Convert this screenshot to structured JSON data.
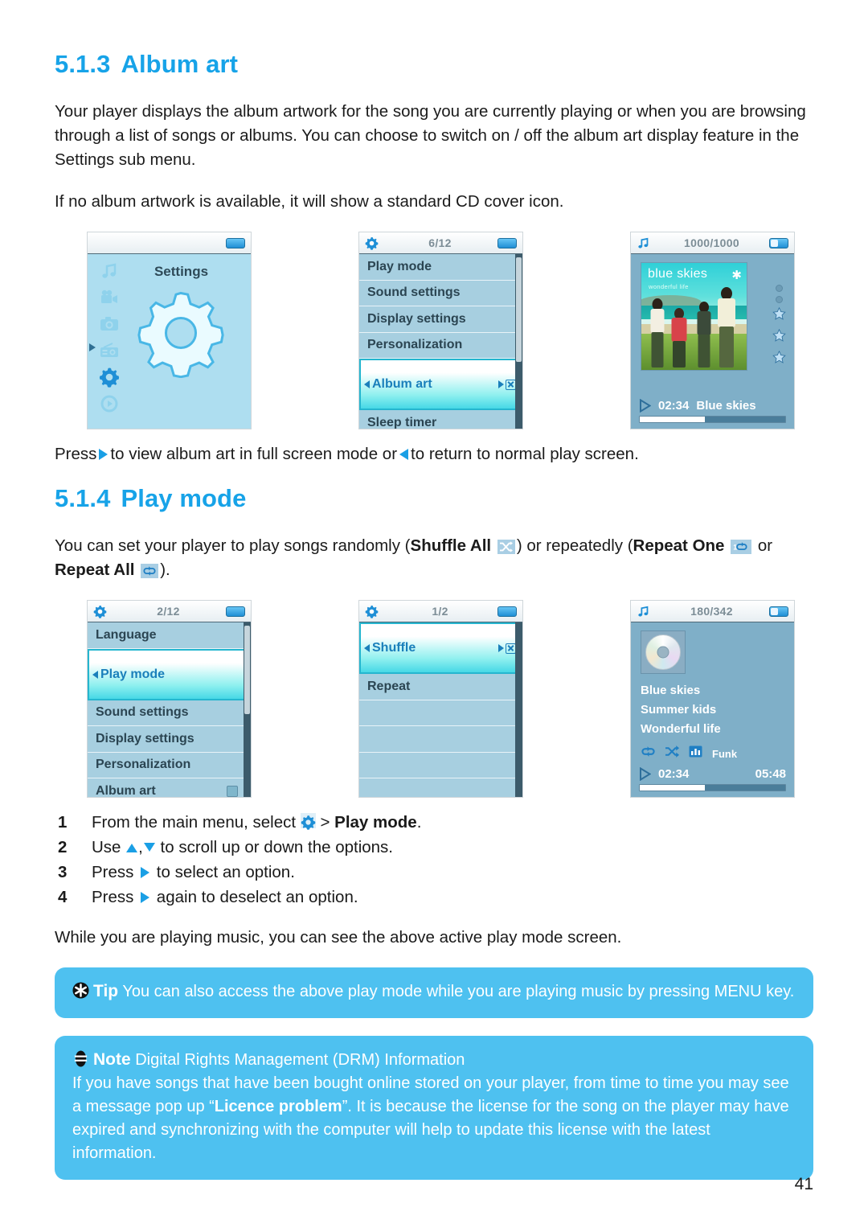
{
  "page": {
    "number": "41",
    "accent_color": "#17A3E8",
    "callout_bg": "#4EC1F0"
  },
  "section_album_art": {
    "num": "5.1.3",
    "title": "Album art",
    "paragraph_1": "Your player displays the album artwork for the song you are currently playing or when you are browsing through a list of songs or albums. You can choose to switch on / off the album art display feature in the Settings sub menu.",
    "paragraph_2": "If no album artwork is available, it will show a standard CD cover icon.",
    "caption_before": "Press",
    "caption_mid": "to view album art in full screen mode or",
    "caption_after": "to return to normal play screen."
  },
  "screens_row1": {
    "screen1": {
      "header_counter": "",
      "title": "Settings",
      "sidebar_icons": [
        "music-note-icon",
        "video-camera-icon",
        "photo-camera-icon",
        "radio-icon",
        "gear-icon",
        "play-circle-icon"
      ],
      "selected_index": 4
    },
    "screen2": {
      "header_icon": "gear-icon",
      "header_counter": "6/12",
      "items": [
        {
          "label": "Play mode",
          "selected": false
        },
        {
          "label": "Sound settings",
          "selected": false
        },
        {
          "label": "Display settings",
          "selected": false
        },
        {
          "label": "Personalization",
          "selected": false
        },
        {
          "label": "Album art",
          "selected": true
        },
        {
          "label": "Sleep timer",
          "selected": false
        }
      ]
    },
    "screen3": {
      "header_icon": "music-note-icon",
      "header_counter": "1000/1000",
      "album_title": "blue skies",
      "album_subtitle": "wonderful life",
      "time": "02:34",
      "track": "Blue skies",
      "rating_dots": 2,
      "rating_stars": 3
    }
  },
  "section_play_mode": {
    "num": "5.1.4",
    "title": "Play mode",
    "intro_a": "You can set your player to play songs randomly (",
    "shuffle_all": "Shuffle All",
    "intro_b": ") or repeatedly (",
    "repeat_one_bold": "Repeat",
    "repeat_one_bold2": "One",
    "intro_c": " or ",
    "repeat_all": "Repeat All",
    "intro_d": ")."
  },
  "screens_row2": {
    "screen1": {
      "header_icon": "gear-icon",
      "header_counter": "2/12",
      "items": [
        {
          "label": "Language",
          "selected": false
        },
        {
          "label": "Play mode",
          "selected": true
        },
        {
          "label": "Sound settings",
          "selected": false
        },
        {
          "label": "Display settings",
          "selected": false
        },
        {
          "label": "Personalization",
          "selected": false
        },
        {
          "label": "Album art",
          "selected": false,
          "checkbox": true
        }
      ]
    },
    "screen2": {
      "header_icon": "gear-icon",
      "header_counter": "1/2",
      "items": [
        {
          "label": "Shuffle",
          "selected": true
        },
        {
          "label": "Repeat",
          "selected": false
        }
      ]
    },
    "screen3": {
      "header_icon": "music-note-icon",
      "header_counter": "180/342",
      "cover_icon": "cd-jewel-case-icon",
      "track": "Blue skies",
      "artist": "Summer kids",
      "album": "Wonderful life",
      "mode_icons": [
        "repeat-all-icon",
        "shuffle-icon",
        "equalizer-icon"
      ],
      "eq_label": "Funk",
      "elapsed": "02:34",
      "duration": "05:48"
    }
  },
  "steps": [
    {
      "n": "1",
      "text_a": "From the main menu, select ",
      "icon": "gear-icon",
      "text_b": " > ",
      "bold": "Play mode",
      "text_c": "."
    },
    {
      "n": "2",
      "text_a": "Use ",
      "icon": "up-down-arrows",
      "text_b": " to scroll up or down the options."
    },
    {
      "n": "3",
      "text_a": "Press ",
      "icon": "right-arrow",
      "text_b": " to select an option."
    },
    {
      "n": "4",
      "text_a": "Press ",
      "icon": "right-arrow",
      "text_b": " again to deselect an option."
    }
  ],
  "closing_paragraph": "While you are playing music, you can see the above active play mode screen.",
  "tip_callout": {
    "icon": "tip-asterisk-icon",
    "lead": "Tip",
    "text": "You can also access the above play mode while you are playing music by pressing MENU key."
  },
  "note_callout": {
    "icon": "note-icon",
    "lead": "Note",
    "heading_rest": "Digital Rights Management (DRM) Information",
    "body_a": "If you have songs that have been bought online stored on your player, from time to time you may see a message pop up “",
    "bold": "Licence problem",
    "body_b": "”. It is because the license for the song on the player may have expired and synchronizing with the computer will help to update this license with the latest information."
  }
}
